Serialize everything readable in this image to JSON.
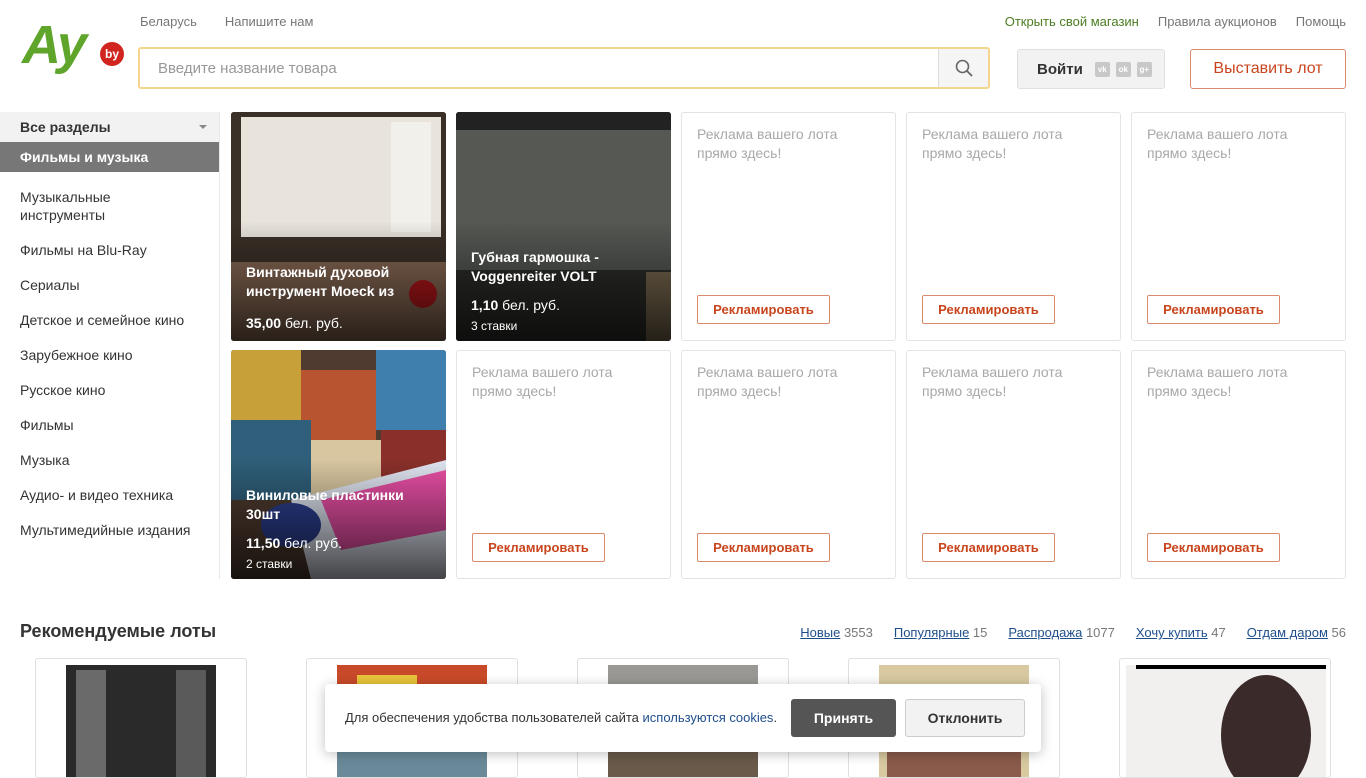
{
  "header": {
    "logo_text": "Ay",
    "logo_badge": "by",
    "left_links": [
      "Беларусь",
      "Напишите нам"
    ],
    "right_links": [
      "Открыть свой магазин",
      "Правила аукционов",
      "Помощь"
    ],
    "search_placeholder": "Введите название товара",
    "login_label": "Войти",
    "social": [
      "vk",
      "ok",
      "g+"
    ],
    "post_lot_label": "Выставить лот"
  },
  "sidebar": {
    "all_sections": "Все разделы",
    "active_section": "Фильмы и музыка",
    "categories": [
      "Музыкальные инструменты",
      "Фильмы на Blu-Ray",
      "Сериалы",
      "Детское и семейное кино",
      "Зарубежное кино",
      "Русское кино",
      "Фильмы",
      "Музыка",
      "Аудио- и видео техника",
      "Мультимедийные издания"
    ]
  },
  "lots": [
    {
      "title": "Винтажный духовой инструмент Moeck из",
      "price": "35,00",
      "currency": "бел. руб.",
      "bids": ""
    },
    {
      "title": "Губная гармошка - Voggenreiter VOLT",
      "price": "1,10",
      "currency": "бел. руб.",
      "bids": "3 ставки"
    },
    {
      "title": "Виниловые пластинки 30шт",
      "price": "11,50",
      "currency": "бел. руб.",
      "bids": "2 ставки"
    }
  ],
  "ad": {
    "text": "Реклама вашего лота прямо здесь!",
    "button": "Рекламировать"
  },
  "recommended": {
    "title": "Рекомендуемые лоты",
    "tabs": [
      {
        "label": "Новые",
        "count": "3553"
      },
      {
        "label": "Популярные",
        "count": "15"
      },
      {
        "label": "Распродажа",
        "count": "1077"
      },
      {
        "label": "Хочу купить",
        "count": "47"
      },
      {
        "label": "Отдам даром",
        "count": "56"
      }
    ]
  },
  "cookie": {
    "text": "Для обеспечения удобства пользователей сайта",
    "link": "используются cookies",
    "period": ".",
    "accept": "Принять",
    "decline": "Отклонить"
  },
  "colors": {
    "brand_green": "#5fa52b",
    "accent_orange": "#c9451d",
    "link_blue": "#1f4e8c"
  }
}
